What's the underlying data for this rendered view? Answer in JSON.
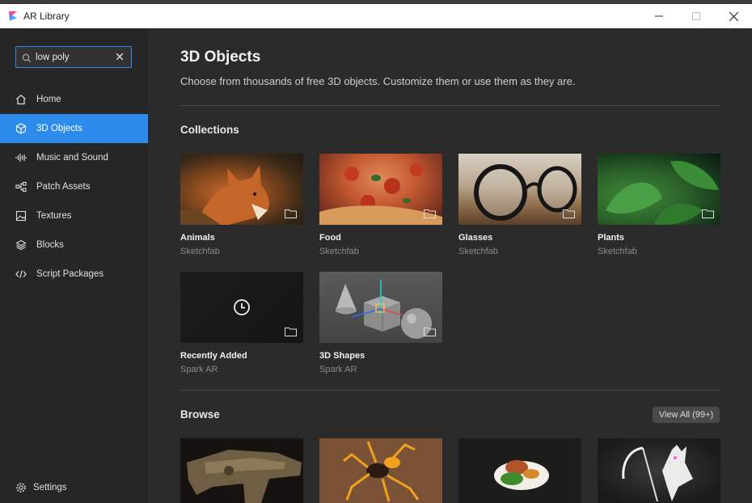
{
  "window": {
    "title": "AR Library",
    "controls": [
      "minimize-icon",
      "maximize-icon",
      "close-icon"
    ]
  },
  "sidebar": {
    "search": {
      "value": "low poly",
      "placeholder": "",
      "icon": "search-icon",
      "clear_icon": "clear-icon"
    },
    "items": [
      {
        "label": "Home",
        "icon": "home-icon",
        "active": false
      },
      {
        "label": "3D Objects",
        "icon": "cube-icon",
        "active": true
      },
      {
        "label": "Music and Sound",
        "icon": "audio-wave-icon",
        "active": false
      },
      {
        "label": "Patch Assets",
        "icon": "patch-nodes-icon",
        "active": false
      },
      {
        "label": "Textures",
        "icon": "image-icon",
        "active": false
      },
      {
        "label": "Blocks",
        "icon": "block-icon",
        "active": false
      },
      {
        "label": "Script Packages",
        "icon": "code-icon",
        "active": false
      }
    ],
    "settings_label": "Settings",
    "settings_icon": "gear-icon"
  },
  "main": {
    "title": "3D Objects",
    "subtitle": "Choose from thousands of free 3D objects. Customize them or use them as they are.",
    "collections_title": "Collections",
    "collections": [
      {
        "title": "Animals",
        "source": "Sketchfab"
      },
      {
        "title": "Food",
        "source": "Sketchfab"
      },
      {
        "title": "Glasses",
        "source": "Sketchfab"
      },
      {
        "title": "Plants",
        "source": "Sketchfab"
      },
      {
        "title": "Recently Added",
        "source": "Spark AR"
      },
      {
        "title": "3D Shapes",
        "source": "Spark AR"
      }
    ],
    "browse_title": "Browse",
    "view_all_label": "View All (99+)"
  },
  "colors": {
    "accent": "#2d8ceb",
    "sidebar_bg": "#262626",
    "main_bg": "#2b2b2b",
    "titlebar_bg": "#ffffff"
  }
}
